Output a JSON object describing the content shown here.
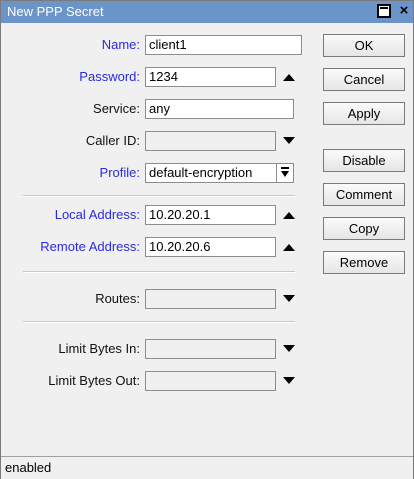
{
  "window": {
    "title": "New PPP Secret",
    "title_bg": "#6b95c9"
  },
  "form": {
    "name": {
      "label": "Name:",
      "value": "client1"
    },
    "password": {
      "label": "Password:",
      "value": "1234"
    },
    "service": {
      "label": "Service:",
      "value": "any"
    },
    "caller_id": {
      "label": "Caller ID:",
      "value": ""
    },
    "profile": {
      "label": "Profile:",
      "value": "default-encryption"
    },
    "local_address": {
      "label": "Local Address:",
      "value": "10.20.20.1"
    },
    "remote_address": {
      "label": "Remote Address:",
      "value": "10.20.20.6"
    },
    "routes": {
      "label": "Routes:",
      "value": ""
    },
    "limit_bytes_in": {
      "label": "Limit Bytes In:",
      "value": ""
    },
    "limit_bytes_out": {
      "label": "Limit Bytes Out:",
      "value": ""
    }
  },
  "buttons": {
    "ok": "OK",
    "cancel": "Cancel",
    "apply": "Apply",
    "disable": "Disable",
    "comment": "Comment",
    "copy": "Copy",
    "remove": "Remove"
  },
  "status": "enabled",
  "colors": {
    "accent_label": "#2a2ae0",
    "window_bg": "#f0f0f0"
  }
}
